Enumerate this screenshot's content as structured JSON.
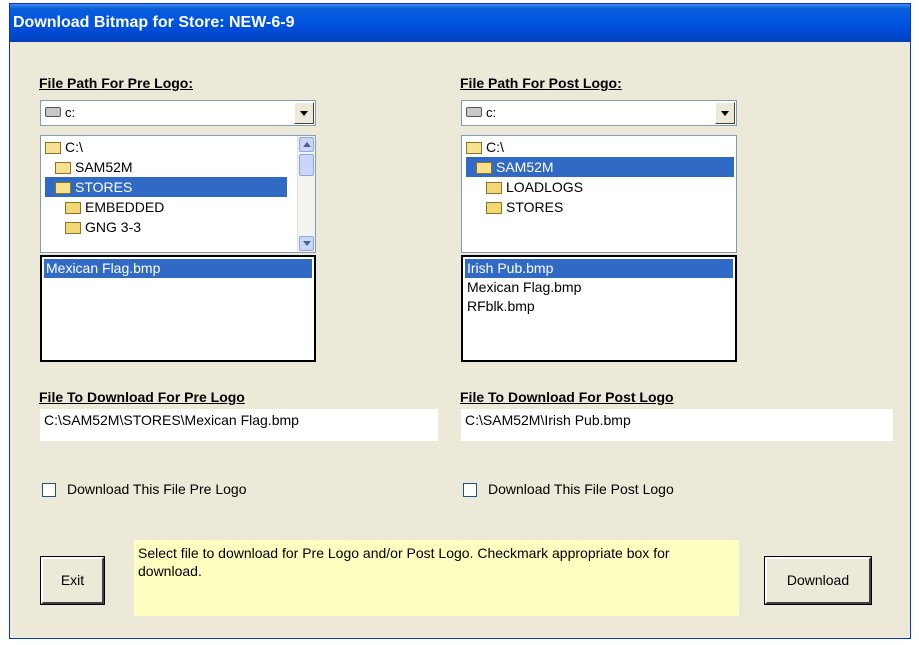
{
  "window": {
    "title": "Download Bitmap for Store: NEW-6-9"
  },
  "pre": {
    "heading": "File Path For Pre Logo:",
    "drive": "c:",
    "folders": [
      {
        "label": "C:\\",
        "selected": false
      },
      {
        "label": "SAM52M",
        "selected": false
      },
      {
        "label": "STORES",
        "selected": true
      },
      {
        "label": "EMBEDDED",
        "selected": false
      },
      {
        "label": "GNG 3-3",
        "selected": false
      }
    ],
    "files": [
      {
        "label": "Mexican Flag.bmp",
        "selected": true
      }
    ],
    "download_heading": "File To Download For Pre Logo",
    "download_path": "C:\\SAM52M\\STORES\\Mexican Flag.bmp",
    "checkbox_label": "Download This File Pre Logo",
    "checked": false
  },
  "post": {
    "heading": "File Path For Post Logo:",
    "drive": "c:",
    "folders": [
      {
        "label": "C:\\",
        "selected": false
      },
      {
        "label": "SAM52M",
        "selected": true
      },
      {
        "label": "LOADLOGS",
        "selected": false
      },
      {
        "label": "STORES",
        "selected": false
      }
    ],
    "files": [
      {
        "label": "Irish Pub.bmp",
        "selected": true
      },
      {
        "label": "Mexican Flag.bmp",
        "selected": false
      },
      {
        "label": "RFblk.bmp",
        "selected": false
      }
    ],
    "download_heading": "File To Download For Post Logo",
    "download_path": "C:\\SAM52M\\Irish Pub.bmp",
    "checkbox_label": "Download This File Post Logo",
    "checked": false
  },
  "buttons": {
    "exit": "Exit",
    "download": "Download"
  },
  "message": "Select file to download for Pre Logo and/or Post Logo.  Checkmark appropriate box for download.",
  "colors": {
    "titlebar": "#0054e3",
    "selection": "#316ac5",
    "window_bg": "#ece9d8",
    "message_bg": "#ffffc0"
  }
}
